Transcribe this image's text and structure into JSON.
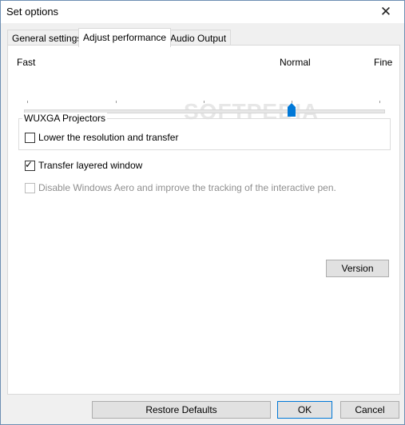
{
  "window": {
    "title": "Set options",
    "close_glyph": "✕"
  },
  "tabs": [
    {
      "label": "General settings",
      "active": false
    },
    {
      "label": "Adjust performance",
      "active": true
    },
    {
      "label": "Audio Output",
      "active": false
    }
  ],
  "slider": {
    "label_left": "Fast",
    "label_mid": "Normal",
    "label_right": "Fine",
    "tick_count": 5,
    "selected_index": 3,
    "level": 0.75
  },
  "watermark": "SOFTPEDIA",
  "group": {
    "title": "WUXGA Projectors",
    "lower_resolution": {
      "label": "Lower the resolution and transfer",
      "checked": false
    }
  },
  "layered_window": {
    "label": "Transfer layered window",
    "checked": true
  },
  "disable_aero": {
    "label": "Disable Windows Aero and improve the tracking of the interactive pen.",
    "checked": false,
    "enabled": false
  },
  "buttons": {
    "version": "Version",
    "restore_defaults": "Restore Defaults",
    "ok": "OK",
    "cancel": "Cancel"
  },
  "icons": {
    "close": "close-icon",
    "check": "check-icon",
    "thumb": "slider-thumb"
  },
  "colors": {
    "thumb": "#0078d7",
    "default_border": "#0078d7"
  }
}
